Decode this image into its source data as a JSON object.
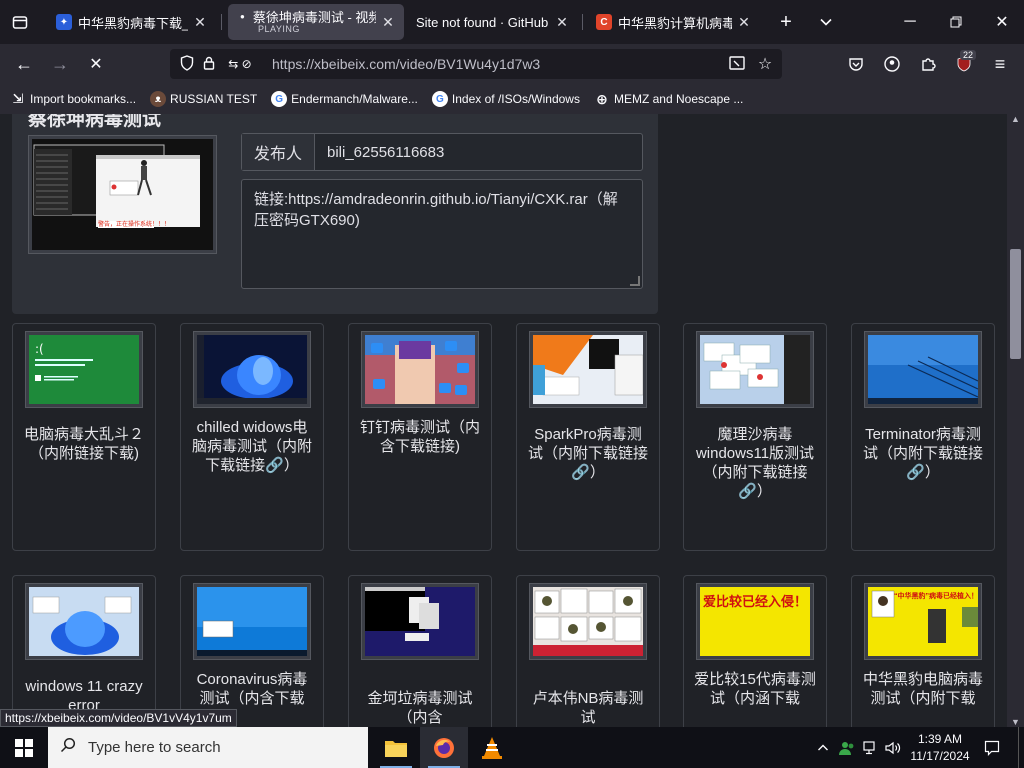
{
  "tabs": [
    {
      "title": "中华黑豹病毒下载_百度",
      "sub": ""
    },
    {
      "title": "蔡徐坤病毒测试 - 视频",
      "sub": "PLAYING"
    },
    {
      "title": "Site not found · GitHub Pag",
      "sub": ""
    },
    {
      "title": "中华黑豹计算机病毒,另",
      "sub": ""
    }
  ],
  "nav": {
    "url": "https://xbeibeix.com/video/BV1Wu4y1d7w3",
    "extensions_badge": "22"
  },
  "bookmarks": [
    "Import bookmarks...",
    "RUSSIAN TEST",
    "Endermanch/Malware...",
    "Index of /ISOs/Windows",
    "MEMZ and Noescape ..."
  ],
  "video": {
    "title": "蔡徐坤病毒测试",
    "thumb_text": "警告，正在操作系统！！！",
    "publisher_label": "发布人",
    "publisher": "bili_62556116683",
    "link_text": "链接:https://amdradeonrin.github.io/Tianyi/CXK.rar（解压密码GTX690)"
  },
  "row1": [
    {
      "caption": "电脑病毒大乱斗２（内附链接下载)"
    },
    {
      "caption": "chilled widows电脑病毒测试（内附下载链接🔗）"
    },
    {
      "caption": "钉钉病毒测试（内含下载链接)"
    },
    {
      "caption": "SparkPro病毒测试（内附下载链接🔗）"
    },
    {
      "caption": "魔理沙病毒windows11版测试（内附下载链接🔗）"
    },
    {
      "caption": "Terminator病毒测试（内附下载链接🔗）"
    }
  ],
  "row2": [
    {
      "caption": "windows 11 crazy error"
    },
    {
      "caption": "Coronavirus病毒测试（内含下载"
    },
    {
      "caption": "金坷垃病毒测试（内含"
    },
    {
      "caption": "卢本伟NB病毒测试"
    },
    {
      "caption": "爱比较15代病毒测试（内涵下载",
      "thumb_text": "爱比较已经入侵！"
    },
    {
      "caption": "中华黑豹电脑病毒测试（内附下载",
      "thumb_text": "“中华黑豹”病毒已经植入！"
    }
  ],
  "status_url": "https://xbeibeix.com/video/BV1vV4y1v7um",
  "taskbar": {
    "search_placeholder": "Type here to search",
    "time": "1:39 AM",
    "date": "11/17/2024"
  }
}
